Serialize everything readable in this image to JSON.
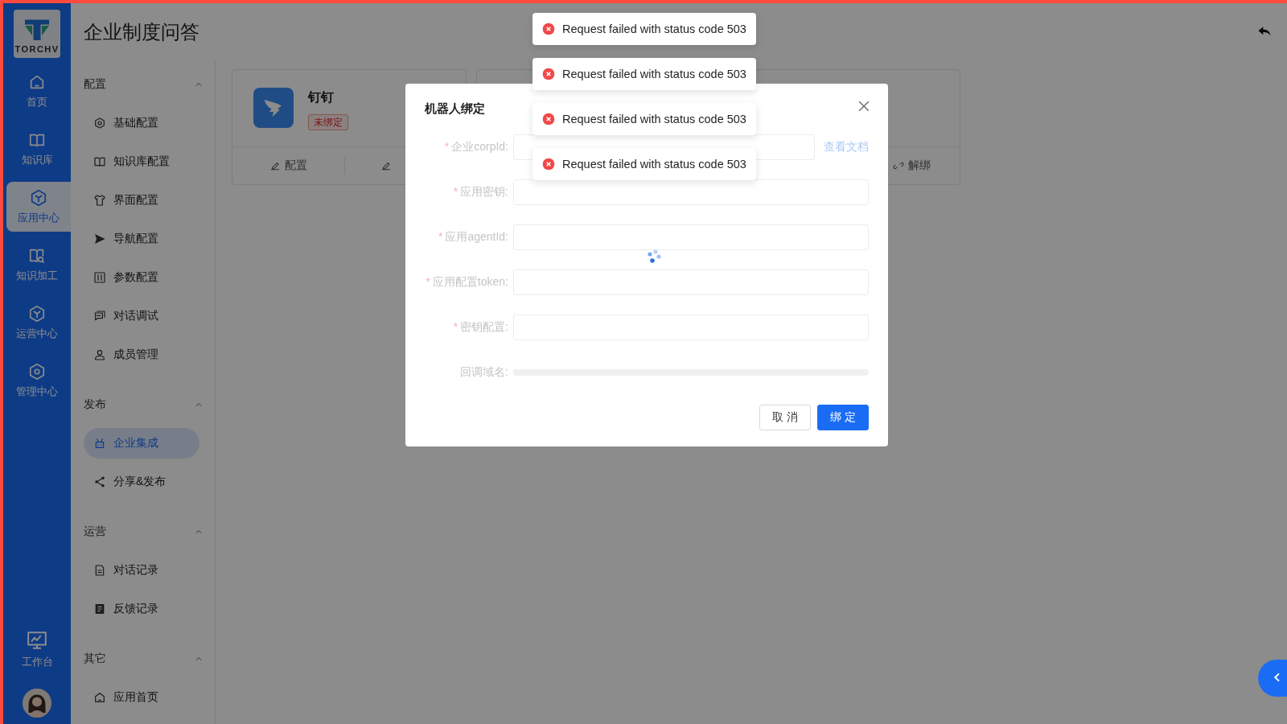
{
  "logo": {
    "text": "TORCHV"
  },
  "rail": {
    "items": [
      {
        "label": "首页",
        "selected": false
      },
      {
        "label": "知识库",
        "selected": false
      },
      {
        "label": "应用中心",
        "selected": true
      },
      {
        "label": "知识加工",
        "selected": false
      },
      {
        "label": "运营中心",
        "selected": false
      },
      {
        "label": "管理中心",
        "selected": false
      }
    ],
    "bottom": {
      "label": "工作台"
    }
  },
  "page": {
    "title": "企业制度问答"
  },
  "menu": {
    "groups": [
      {
        "title": "配置",
        "expanded": true,
        "items": [
          {
            "label": "基础配置",
            "selected": false
          },
          {
            "label": "知识库配置",
            "selected": false
          },
          {
            "label": "界面配置",
            "selected": false
          },
          {
            "label": "导航配置",
            "selected": false
          },
          {
            "label": "参数配置",
            "selected": false
          },
          {
            "label": "对话调试",
            "selected": false
          },
          {
            "label": "成员管理",
            "selected": false
          }
        ]
      },
      {
        "title": "发布",
        "expanded": true,
        "items": [
          {
            "label": "企业集成",
            "selected": true
          },
          {
            "label": "分享&发布",
            "selected": false
          }
        ]
      },
      {
        "title": "运营",
        "expanded": true,
        "items": [
          {
            "label": "对话记录",
            "selected": false
          },
          {
            "label": "反馈记录",
            "selected": false
          }
        ]
      },
      {
        "title": "其它",
        "expanded": true,
        "items": [
          {
            "label": "应用首页",
            "selected": false
          }
        ]
      }
    ]
  },
  "cards": [
    {
      "name": "钉钉",
      "status": "未绑定",
      "actions": [
        {
          "kind": "text",
          "label": "配置"
        },
        {
          "kind": "icon"
        }
      ]
    },
    {
      "actions": [
        {
          "kind": "text",
          "label": "解绑"
        }
      ]
    }
  ],
  "dialog": {
    "title": "机器人绑定",
    "loading": true,
    "fields": [
      {
        "kind": "input",
        "required_mark": "*",
        "label": "企业corpId:",
        "link": "查看文档"
      },
      {
        "kind": "input",
        "required_mark": "*",
        "label": "应用密钥:"
      },
      {
        "kind": "input",
        "required_mark": "*",
        "label": "应用agentId:"
      },
      {
        "kind": "input",
        "required_mark": "*",
        "label": "应用配置token:"
      },
      {
        "kind": "input",
        "required_mark": "*",
        "label": "密钥配置:"
      },
      {
        "kind": "skeleton",
        "label": "回调域名:"
      }
    ],
    "buttons": [
      {
        "kind": "default",
        "label": "取 消"
      },
      {
        "kind": "primary",
        "label": "绑 定"
      }
    ]
  },
  "toasts": [
    {
      "message": "Request failed with status code 503"
    },
    {
      "message": "Request failed with status code 503"
    },
    {
      "message": "Request failed with status code 503"
    },
    {
      "message": "Request failed with status code 503"
    }
  ]
}
